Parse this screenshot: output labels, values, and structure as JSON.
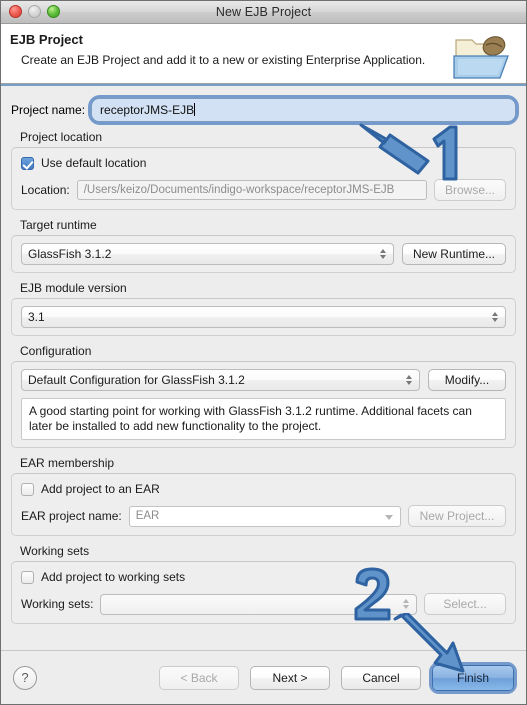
{
  "window": {
    "title": "New EJB Project",
    "traffic_lights": [
      "close-red",
      "minimize-gray",
      "zoom-green"
    ]
  },
  "banner": {
    "title": "EJB Project",
    "description": "Create an EJB Project and add it to a new or existing Enterprise Application.",
    "icon": "ejb-project-folder-icon"
  },
  "project_name": {
    "label": "Project name:",
    "value": "receptorJMS-EJB",
    "focused": true
  },
  "project_location": {
    "group_label": "Project location",
    "use_default_label": "Use default location",
    "use_default_checked": true,
    "location_label": "Location:",
    "location_value": "/Users/keizo/Documents/indigo-workspace/receptorJMS-EJB",
    "browse_label": "Browse..."
  },
  "target_runtime": {
    "group_label": "Target runtime",
    "value": "GlassFish 3.1.2",
    "new_runtime_label": "New Runtime..."
  },
  "ejb_module_version": {
    "group_label": "EJB module version",
    "value": "3.1"
  },
  "configuration": {
    "group_label": "Configuration",
    "value": "Default Configuration for GlassFish 3.1.2",
    "modify_label": "Modify...",
    "description": "A good starting point for working with GlassFish 3.1.2 runtime. Additional facets can later be installed to add new functionality to the project."
  },
  "ear_membership": {
    "group_label": "EAR membership",
    "add_to_ear_label": "Add project to an EAR",
    "add_to_ear_checked": false,
    "ear_name_label": "EAR project name:",
    "ear_name_value": "EAR",
    "new_project_label": "New Project..."
  },
  "working_sets": {
    "group_label": "Working sets",
    "add_to_working_sets_label": "Add project to working sets",
    "add_to_working_sets_checked": false,
    "working_sets_label": "Working sets:",
    "working_sets_value": "",
    "select_label": "Select..."
  },
  "footer": {
    "help_label": "?",
    "back_label": "< Back",
    "back_enabled": false,
    "next_label": "Next >",
    "cancel_label": "Cancel",
    "finish_label": "Finish",
    "finish_default": true
  },
  "annotations": [
    {
      "number": "1",
      "target": "project-name-input",
      "arrow": "up-left"
    },
    {
      "number": "2",
      "target": "finish-button",
      "arrow": "down-right"
    }
  ],
  "colors": {
    "annotation_fill": "#5f93c9",
    "annotation_stroke": "#2f62a0",
    "focus_ring": "#5686c4",
    "default_button": "#6fa0da",
    "focused_field_bg": "#d2e2f4"
  }
}
